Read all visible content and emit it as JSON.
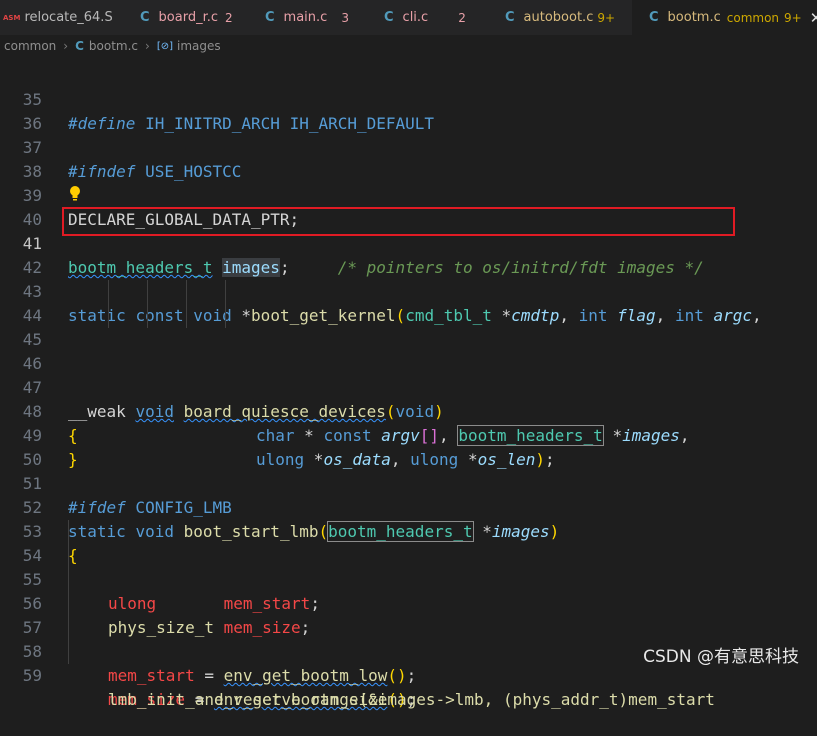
{
  "tabs": [
    {
      "icon": "ASM",
      "name": "relocate_64.S",
      "count": ""
    },
    {
      "icon": "C",
      "name": "board_r.c",
      "count": "2"
    },
    {
      "icon": "C",
      "name": "main.c",
      "count": "3"
    },
    {
      "icon": "C",
      "name": "cli.c",
      "count": "2"
    },
    {
      "icon": "C",
      "name": "autoboot.c",
      "count": "9+"
    },
    {
      "icon": "C",
      "name": "bootm.c",
      "meta": "common",
      "count": "9+",
      "close": "✕"
    }
  ],
  "breadcrumb": {
    "folder": "common",
    "file_icon": "C",
    "file": "bootm.c",
    "symbol_icon": "[⊘]",
    "symbol": "images"
  },
  "line_numbers": [
    "35",
    "36",
    "37",
    "38",
    "39",
    "40",
    "41",
    "42",
    "43",
    "44",
    "45",
    "46",
    "47",
    "48",
    "49",
    "50",
    "51",
    "52",
    "53",
    "54",
    "55",
    "56",
    "57",
    "58",
    "59"
  ],
  "code": {
    "l35": [
      "#define",
      " IH_INITRD_ARCH IH_ARCH_DEFAULT"
    ],
    "l37": [
      "#ifndef",
      " USE_HOSTCC"
    ],
    "l39": [
      "DECLARE_GLOBAL_DATA_PTR;"
    ],
    "l41": [
      "bootm_headers_t",
      " ",
      "images",
      ";",
      "     ",
      "/* pointers to os/initrd/fdt images */"
    ],
    "l43": [
      "static",
      " ",
      "const",
      " ",
      "void",
      " *",
      "boot_get_kernel",
      "(",
      "cmd_tbl_t",
      " *",
      "cmdtp",
      ", ",
      "int",
      " ",
      "flag",
      ", ",
      "int",
      " ",
      "argc",
      ","
    ],
    "l44": [
      "char",
      " * ",
      "const",
      " ",
      "argv",
      "[]",
      ", ",
      "bootm_headers_t",
      " *",
      "images",
      ","
    ],
    "l45": [
      "ulong",
      " *",
      "os_data",
      ", ",
      "ulong",
      " *",
      "os_len",
      ")",
      ";"
    ],
    "l47": [
      "__weak",
      " ",
      "void",
      " ",
      "board_quiesce_devices",
      "(",
      "void",
      ")"
    ],
    "l48": [
      "{"
    ],
    "l49": [
      "}"
    ],
    "l51": [
      "#ifdef",
      " CONFIG_LMB"
    ],
    "l52": [
      "static",
      " ",
      "void",
      " ",
      "boot_start_lmb",
      "(",
      "bootm_headers_t",
      " *",
      "images",
      ")"
    ],
    "l53": [
      "{"
    ],
    "l54": [
      "ulong",
      "       ",
      "mem_start",
      ";"
    ],
    "l55": [
      "phys_size_t",
      " ",
      "mem_size",
      ";"
    ],
    "l57": [
      "mem_start",
      " = ",
      "env_get_bootm_low",
      "()",
      ";"
    ],
    "l58": [
      "mem_size",
      " = ",
      "env_get_bootm_size",
      "()",
      ";"
    ],
    "l59": [
      "lmb_init_and_reserve_range(&images->lmb, (phys_addr_t)mem_start"
    ]
  },
  "watermark": "CSDN @有意思科技",
  "colors": {
    "background": "#1e1e1e",
    "keyword": "#569cd6",
    "type": "#4ec9b0",
    "function": "#dcdcaa",
    "variable": "#9cdcfe",
    "comment": "#6a9955",
    "highlight_box": "#e01b24"
  },
  "icons": {
    "lightbulb": "lightbulb-icon",
    "close": "close-icon"
  }
}
